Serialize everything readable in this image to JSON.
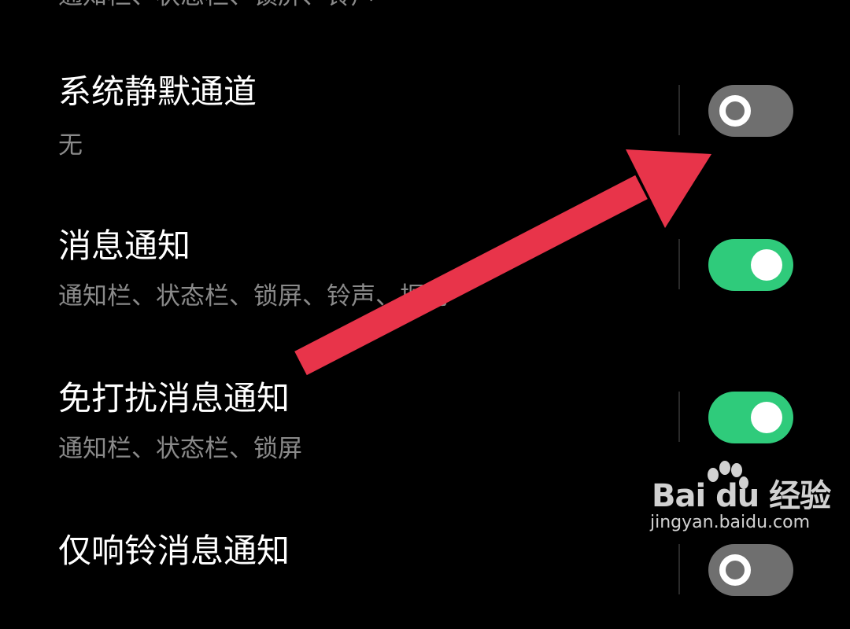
{
  "settings": {
    "top_partial_text": "通知栏、状态栏、锁屏、铃声",
    "items": [
      {
        "title": "系统静默通道",
        "subtitle": "无",
        "enabled": false
      },
      {
        "title": "消息通知",
        "subtitle": "通知栏、状态栏、锁屏、铃声、振动",
        "enabled": true
      },
      {
        "title": "免打扰消息通知",
        "subtitle": "通知栏、状态栏、锁屏",
        "enabled": true
      },
      {
        "title": "仅响铃消息通知",
        "subtitle": "",
        "enabled": false
      }
    ]
  },
  "colors": {
    "background": "#000000",
    "switch_on": "#2fcb7b",
    "switch_off": "#6f6f6f",
    "arrow": "#e8344a"
  },
  "watermark": {
    "logo_text": "Bai du 经验",
    "url": "jingyan.baidu.com"
  }
}
